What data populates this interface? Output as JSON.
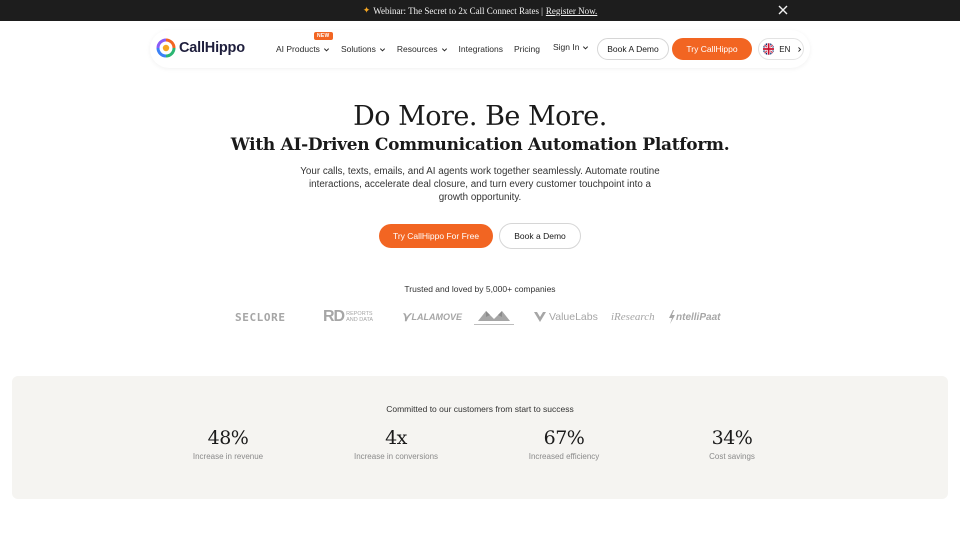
{
  "banner": {
    "text": "Webinar: The Secret to 2x Call Connect Rates",
    "separator": "|",
    "link": "Register Now."
  },
  "nav": {
    "brand": "CallHippo",
    "items": [
      {
        "label": "AI Products",
        "badge": "NEW",
        "dropdown": true
      },
      {
        "label": "Solutions",
        "dropdown": true
      },
      {
        "label": "Resources",
        "dropdown": true
      },
      {
        "label": "Integrations",
        "dropdown": false
      },
      {
        "label": "Pricing",
        "dropdown": false
      }
    ],
    "signin": "Sign In",
    "book_demo": "Book A Demo",
    "try": "Try CallHippo",
    "language": "EN"
  },
  "hero": {
    "title": "Do More. Be More.",
    "subtitle": "With AI-Driven Communication Automation Platform.",
    "description": "Your calls, texts, emails, and AI agents work together seamlessly. Automate routine interactions, accelerate deal closure, and turn every customer touchpoint into a growth opportunity.",
    "cta_primary": "Try CallHippo For Free",
    "cta_secondary": "Book a Demo"
  },
  "trusted": {
    "text": "Trusted and loved by 5,000+ companies",
    "logos": {
      "seclore": "SECLORE",
      "rd_mark": "RD",
      "rd_line1": "REPORTS",
      "rd_line2": "AND DATA",
      "lalamove": "LALAMOVE",
      "valuelabs": "ValueLabs",
      "iresearch": "iResearch",
      "intellipaat": "ntelliPaat"
    }
  },
  "stats": {
    "caption": "Committed to our customers from start to success",
    "items": [
      {
        "value": "48%",
        "label": "Increase in revenue"
      },
      {
        "value": "4x",
        "label": "Increase in conversions"
      },
      {
        "value": "67%",
        "label": "Increased efficiency"
      },
      {
        "value": "34%",
        "label": "Cost savings"
      }
    ]
  },
  "colors": {
    "accent": "#f26522",
    "banner_bg": "#1d1d1d",
    "stats_bg": "#f5f4f1",
    "logo_gray": "#a6a6a6"
  },
  "icons": [
    "sparkle-icon",
    "close-icon",
    "callhippo-logo-icon",
    "chevron-down-icon",
    "uk-flag-icon",
    "chevron-right-icon"
  ]
}
